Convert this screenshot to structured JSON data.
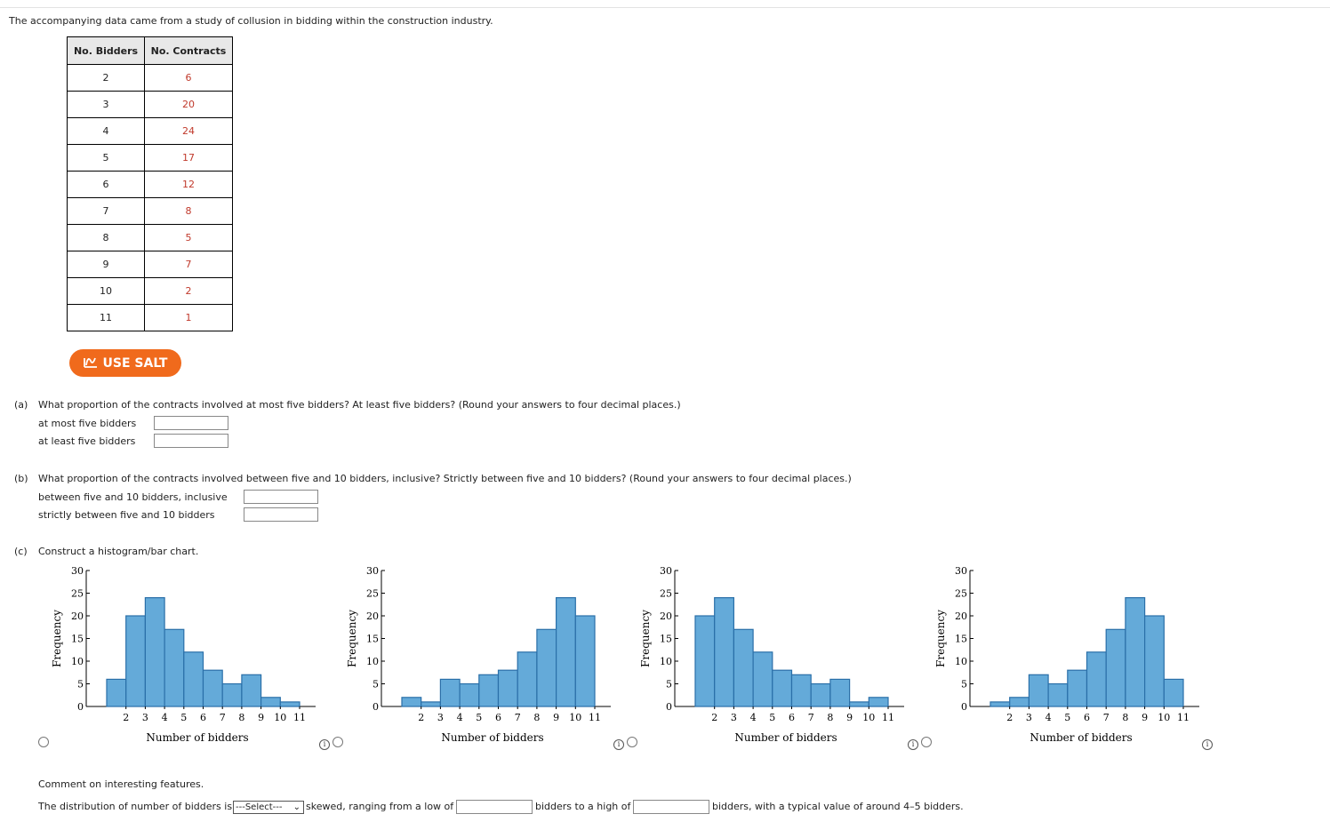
{
  "intro": "The accompanying data came from a study of collusion in bidding within the construction industry.",
  "table": {
    "headers": [
      "No. Bidders",
      "No. Contracts"
    ],
    "rows": [
      [
        "2",
        "6"
      ],
      [
        "3",
        "20"
      ],
      [
        "4",
        "24"
      ],
      [
        "5",
        "17"
      ],
      [
        "6",
        "12"
      ],
      [
        "7",
        "8"
      ],
      [
        "8",
        "5"
      ],
      [
        "9",
        "7"
      ],
      [
        "10",
        "2"
      ],
      [
        "11",
        "1"
      ]
    ]
  },
  "salt_label": "USE SALT",
  "part_a": {
    "label": "(a)",
    "question": "What proportion of the contracts involved at most five bidders? At least five bidders? (Round your answers to four decimal places.)",
    "fields": [
      "at most five bidders",
      "at least five bidders"
    ]
  },
  "part_b": {
    "label": "(b)",
    "question": "What proportion of the contracts involved between five and 10 bidders, inclusive? Strictly between five and 10 bidders? (Round your answers to four decimal places.)",
    "fields": [
      "between five and 10 bidders, inclusive",
      "strictly between five and 10 bidders"
    ]
  },
  "part_c": {
    "label": "(c)",
    "question": "Construct a histogram/bar chart.",
    "comment_heading": "Comment on interesting features.",
    "sentence": {
      "prefix": "The distribution of number of bidders is",
      "select_value": "---Select---",
      "middle1": "skewed, ranging from a low of",
      "middle2": "bidders to a high of",
      "suffix": "bidders, with a typical value of around 4–5 bidders."
    }
  },
  "chart_data": [
    {
      "type": "bar",
      "categories": [
        "2",
        "3",
        "4",
        "5",
        "6",
        "7",
        "8",
        "9",
        "10",
        "11"
      ],
      "values": [
        6,
        20,
        24,
        17,
        12,
        8,
        5,
        7,
        2,
        1
      ],
      "xlabel": "Number of bidders",
      "ylabel": "Frequency",
      "ylim": [
        0,
        30
      ],
      "yticks": [
        0,
        5,
        10,
        15,
        20,
        25,
        30
      ]
    },
    {
      "type": "bar",
      "categories": [
        "2",
        "3",
        "4",
        "5",
        "6",
        "7",
        "8",
        "9",
        "10",
        "11"
      ],
      "values": [
        2,
        1,
        6,
        5,
        7,
        8,
        12,
        17,
        24,
        20
      ],
      "xlabel": "Number of bidders",
      "ylabel": "Frequency",
      "ylim": [
        0,
        30
      ],
      "yticks": [
        0,
        5,
        10,
        15,
        20,
        25,
        30
      ]
    },
    {
      "type": "bar",
      "categories": [
        "2",
        "3",
        "4",
        "5",
        "6",
        "7",
        "8",
        "9",
        "10",
        "11"
      ],
      "values": [
        20,
        24,
        17,
        12,
        8,
        7,
        5,
        6,
        1,
        2
      ],
      "xlabel": "Number of bidders",
      "ylabel": "Frequency",
      "ylim": [
        0,
        30
      ],
      "yticks": [
        0,
        5,
        10,
        15,
        20,
        25,
        30
      ]
    },
    {
      "type": "bar",
      "categories": [
        "2",
        "3",
        "4",
        "5",
        "6",
        "7",
        "8",
        "9",
        "10",
        "11"
      ],
      "values": [
        1,
        2,
        7,
        5,
        8,
        12,
        17,
        24,
        20,
        6
      ],
      "xlabel": "Number of bidders",
      "ylabel": "Frequency",
      "ylim": [
        0,
        30
      ],
      "yticks": [
        0,
        5,
        10,
        15,
        20,
        25,
        30
      ]
    }
  ],
  "colors": {
    "bar_fill": "#64aad9",
    "bar_stroke": "#2a6fa8",
    "salt": "#f06a1c",
    "table_value": "#c0392b"
  }
}
